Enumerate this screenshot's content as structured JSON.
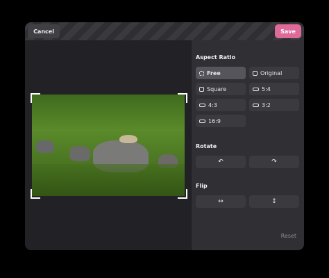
{
  "header": {
    "cancel_label": "Cancel",
    "save_label": "Save"
  },
  "sidebar": {
    "aspect_ratio_title": "Aspect Ratio",
    "aspect_options": [
      {
        "label": "Free",
        "icon": "dashed-square-icon",
        "active": true
      },
      {
        "label": "Original",
        "icon": "square-icon",
        "active": false
      },
      {
        "label": "Square",
        "icon": "square-icon",
        "active": false
      },
      {
        "label": "5:4",
        "icon": "rect-icon",
        "active": false
      },
      {
        "label": "4:3",
        "icon": "rect-icon",
        "active": false
      },
      {
        "label": "3:2",
        "icon": "rect-icon",
        "active": false
      },
      {
        "label": "16:9",
        "icon": "rect-icon",
        "active": false
      }
    ],
    "rotate_title": "Rotate",
    "rotate_left_glyph": "↶",
    "rotate_right_glyph": "↷",
    "flip_title": "Flip",
    "flip_horizontal_glyph": "↔",
    "flip_vertical_glyph": "↕",
    "reset_label": "Reset"
  },
  "colors": {
    "accent": "#de6a9b",
    "window": "#2b2b2f",
    "sidebar": "#303034"
  }
}
